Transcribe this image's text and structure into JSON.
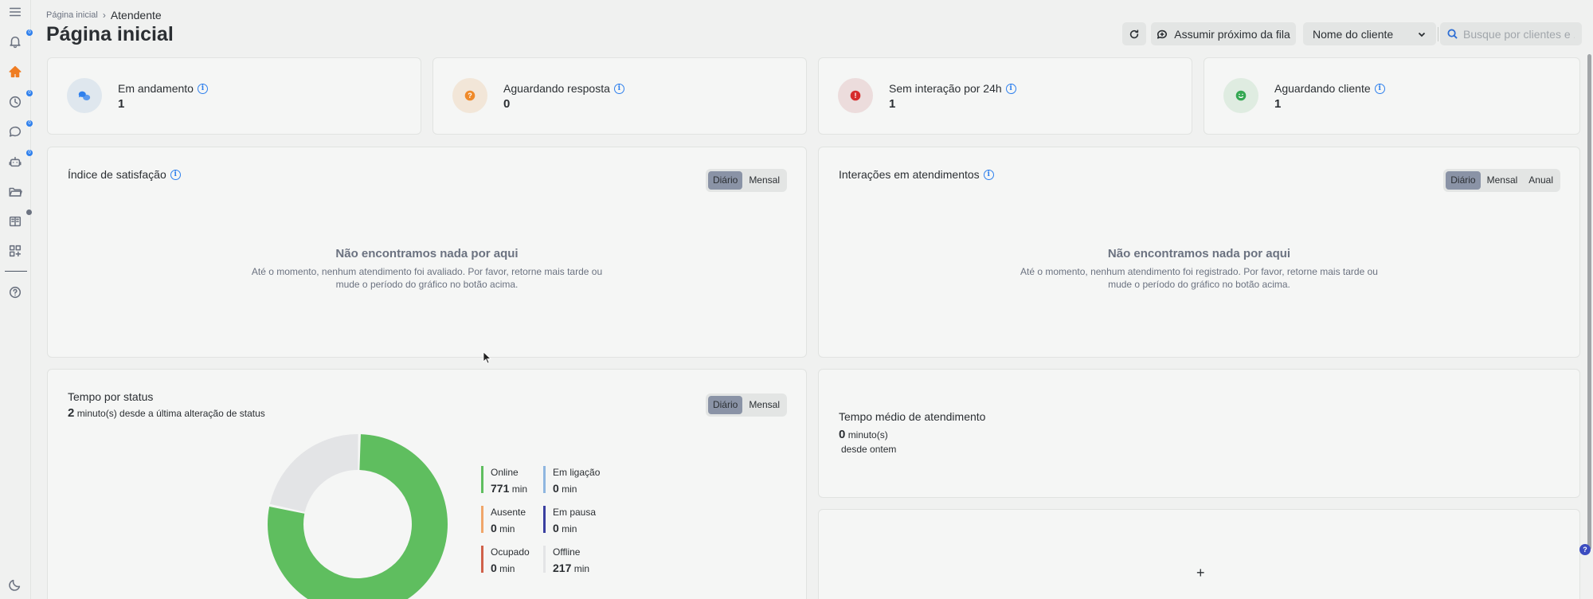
{
  "sidebar": {
    "items": [
      {
        "icon": "menu-icon"
      },
      {
        "icon": "bell-icon",
        "badge": "0"
      },
      {
        "icon": "home-icon",
        "active": true
      },
      {
        "icon": "clock-icon",
        "badge": "0"
      },
      {
        "icon": "chat-icon",
        "badge": "0"
      },
      {
        "icon": "robot-icon",
        "badge": "0"
      },
      {
        "icon": "folder-icon"
      },
      {
        "icon": "book-icon"
      },
      {
        "icon": "apps-icon"
      },
      {
        "icon": "help-icon"
      },
      {
        "icon": "moon-icon"
      }
    ]
  },
  "breadcrumb": {
    "home": "Página inicial",
    "current": "Atendente"
  },
  "page_title": "Página inicial",
  "header": {
    "next_in_queue": "Assumir próximo da fila",
    "client_select": "Nome do cliente",
    "search_placeholder": "Busque por clientes e ..."
  },
  "stats": [
    {
      "label": "Em andamento",
      "value": "1",
      "color": "#2f80ed",
      "bg": "#dfe7ee",
      "icon": "chat-bubbles-icon"
    },
    {
      "label": "Aguardando resposta",
      "value": "0",
      "color": "#ef8a2a",
      "bg": "#f2e6d8",
      "icon": "question-bubble-icon"
    },
    {
      "label": "Sem interação por 24h",
      "value": "1",
      "color": "#d62c2c",
      "bg": "#ecdcdc",
      "icon": "alert-bubble-icon"
    },
    {
      "label": "Aguardando cliente",
      "value": "1",
      "color": "#35a853",
      "bg": "#dfece1",
      "icon": "smile-bubble-icon"
    }
  ],
  "satisfaction": {
    "title": "Índice de satisfação",
    "toggle": [
      "Diário",
      "Mensal"
    ],
    "empty_title": "Não encontramos nada por aqui",
    "empty_text_1": "Até o momento, nenhum atendimento foi avaliado. Por favor, retorne mais tarde ou",
    "empty_text_2": "mude o período do gráfico no botão acima."
  },
  "interactions": {
    "title": "Interações em atendimentos",
    "toggle": [
      "Diário",
      "Mensal",
      "Anual"
    ],
    "empty_title": "Não encontramos nada por aqui",
    "empty_text_1": "Até o momento, nenhum atendimento foi registrado. Por favor, retorne mais tarde ou",
    "empty_text_2": "mude o período do gráfico no botão acima."
  },
  "status_time": {
    "title": "Tempo por status",
    "minutes": "2",
    "subtitle": "minuto(s) desde a última alteração de status",
    "toggle": [
      "Diário",
      "Mensal"
    ],
    "legend": [
      {
        "label": "Online",
        "value": "771",
        "unit": "min",
        "color": "#5fbe5f"
      },
      {
        "label": "Em ligação",
        "value": "0",
        "unit": "min",
        "color": "#8fb6e0"
      },
      {
        "label": "Ausente",
        "value": "0",
        "unit": "min",
        "color": "#f0a66a"
      },
      {
        "label": "Em pausa",
        "value": "0",
        "unit": "min",
        "color": "#3a3fa0"
      },
      {
        "label": "Ocupado",
        "value": "0",
        "unit": "min",
        "color": "#d0614a"
      },
      {
        "label": "Offline",
        "value": "217",
        "unit": "min",
        "color": "#e3e4e6"
      }
    ]
  },
  "avg_time": {
    "title": "Tempo médio de atendimento",
    "value": "0",
    "unit": "minuto(s)",
    "since": "desde ontem"
  },
  "add_widget": "+"
}
